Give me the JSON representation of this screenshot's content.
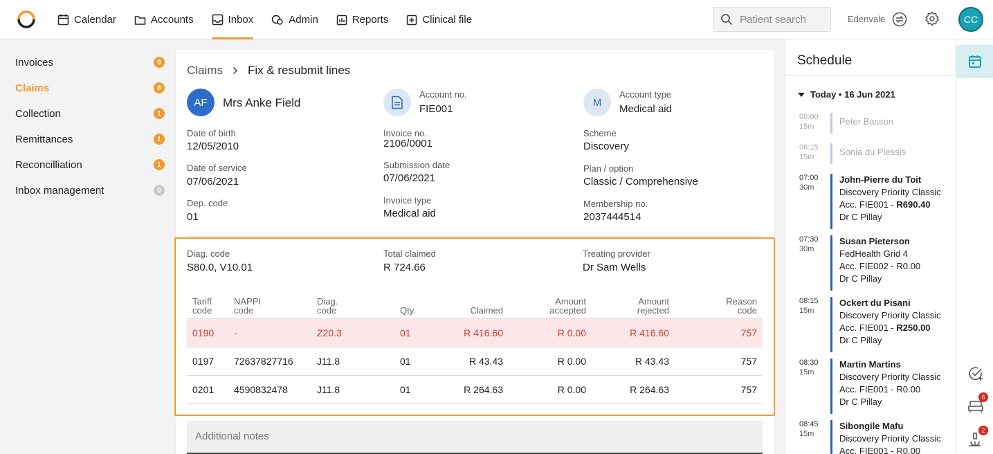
{
  "topbar": {
    "nav": [
      {
        "label": "Calendar",
        "icon": "calendar-icon"
      },
      {
        "label": "Accounts",
        "icon": "folder-icon"
      },
      {
        "label": "Inbox",
        "icon": "inbox-icon",
        "active": true
      },
      {
        "label": "Admin",
        "icon": "admin-icon"
      },
      {
        "label": "Reports",
        "icon": "reports-icon"
      },
      {
        "label": "Clinical file",
        "icon": "plus-box-icon"
      }
    ],
    "search_placeholder": "Patient search",
    "practice": "Edenvale",
    "user_initials": "CC"
  },
  "sidebar": {
    "items": [
      {
        "label": "Invoices",
        "count": "9"
      },
      {
        "label": "Claims",
        "count": "8",
        "active": true
      },
      {
        "label": "Collection",
        "count": "1"
      },
      {
        "label": "Remittances",
        "count": "1"
      },
      {
        "label": "Reconcilliation",
        "count": "1"
      },
      {
        "label": "Inbox management",
        "count": "0"
      }
    ]
  },
  "breadcrumb": {
    "parent": "Claims",
    "current": "Fix & resubmit lines"
  },
  "patient": {
    "initials": "AF",
    "name": "Mrs Anke Field",
    "dob_label": "Date of birth",
    "dob": "12/05/2010",
    "dos_label": "Date of service",
    "dos": "07/06/2021",
    "dep_label": "Dep. code",
    "dep": "01"
  },
  "account": {
    "no_label": "Account no.",
    "no": "FIE001",
    "invoice_label": "Invoice no.",
    "invoice": "2106/0001",
    "submission_label": "Submission date",
    "submission": "07/06/2021",
    "invoice_type_label": "Invoice type",
    "invoice_type": "Medical aid"
  },
  "medical": {
    "initial": "M",
    "type_label": "Account type",
    "type": "Medical aid",
    "scheme_label": "Scheme",
    "scheme": "Discovery",
    "plan_label": "Plan / option",
    "plan": "Classic / Comprehensive",
    "membership_label": "Membership no.",
    "membership": "2037444514"
  },
  "claim": {
    "diag_label": "Diag. code",
    "diag": "S80.0, V10.01",
    "total_label": "Total claimed",
    "total": "R 724.66",
    "provider_label": "Treating provider",
    "provider": "Dr Sam Wells"
  },
  "lines": {
    "headers": [
      {
        "l1": "Tariff",
        "l2": "code"
      },
      {
        "l1": "NAPPI",
        "l2": "code"
      },
      {
        "l1": "Diag.",
        "l2": "code"
      },
      {
        "l1": "",
        "l2": "Qty."
      },
      {
        "l1": "",
        "l2": "Claimed"
      },
      {
        "l1": "Amount",
        "l2": "accepted"
      },
      {
        "l1": "Amount",
        "l2": "rejected"
      },
      {
        "l1": "Reason",
        "l2": "code"
      }
    ],
    "rows": [
      {
        "tariff": "0190",
        "nappi": "-",
        "diag": "Z20.3",
        "qty": "01",
        "claimed": "R 416.60",
        "accepted": "R 0.00",
        "rejected": "R 416.60",
        "reason": "757",
        "error": true
      },
      {
        "tariff": "0197",
        "nappi": "72637827716",
        "diag": "J11.8",
        "qty": "01",
        "claimed": "R 43.43",
        "accepted": "R 0.00",
        "rejected": "R 43.43",
        "reason": "757"
      },
      {
        "tariff": "0201",
        "nappi": "4590832478",
        "diag": "J11.8",
        "qty": "01",
        "claimed": "R 264.63",
        "accepted": "R 0.00",
        "rejected": "R 264.63",
        "reason": "757"
      }
    ]
  },
  "notes": {
    "placeholder": "Additional notes"
  },
  "schedule": {
    "title": "Schedule",
    "day": "Today • 16 Jun 2021",
    "appointments": [
      {
        "time": "06:00",
        "dur": "15m",
        "name": "Peter Basson",
        "past": true
      },
      {
        "time": "06:15",
        "dur": "15m",
        "name": "Sonia du Plessis",
        "past": true
      },
      {
        "time": "07:00",
        "dur": "30m",
        "name": "John-Pierre du Toit",
        "plan": "Discovery Priority Classic",
        "acc": "Acc. FIE001 - ",
        "amount": "R690.40",
        "amount_bold": true,
        "doctor": "Dr C Pillay"
      },
      {
        "time": "07:30",
        "dur": "30m",
        "name": "Susan Pieterson",
        "plan": "FedHealth Grid 4",
        "acc": "Acc. FIE002 - ",
        "amount": "R0.00",
        "doctor": "Dr C Pillay"
      },
      {
        "time": "08:15",
        "dur": "15m",
        "name": "Ockert du Pisani",
        "plan": "Discovery Priority Classic",
        "acc": "Acc. FIE001 - ",
        "amount": "R250.00",
        "amount_bold": true,
        "doctor": "Dr C Pillay"
      },
      {
        "time": "08:30",
        "dur": "15m",
        "name": "Martin Martins",
        "plan": "Discovery Priority Classic",
        "acc": "Acc. FIE001 - ",
        "amount": "R0.00",
        "doctor": "Dr C Pillay"
      },
      {
        "time": "08:45",
        "dur": "15m",
        "name": "Sibongile Mafu",
        "plan": "Discovery Priority Classic",
        "acc": "Acc. FIE001 - ",
        "amount": "R0.00",
        "doctor": ""
      }
    ]
  },
  "rail": {
    "tasks_badge": "",
    "sofa_badge": "6",
    "microscope_badge": "2"
  },
  "colors": {
    "accent": "#f29a2e",
    "teal": "#16a3b3",
    "blue": "#2f5fa8",
    "error": "#d23c2c"
  }
}
